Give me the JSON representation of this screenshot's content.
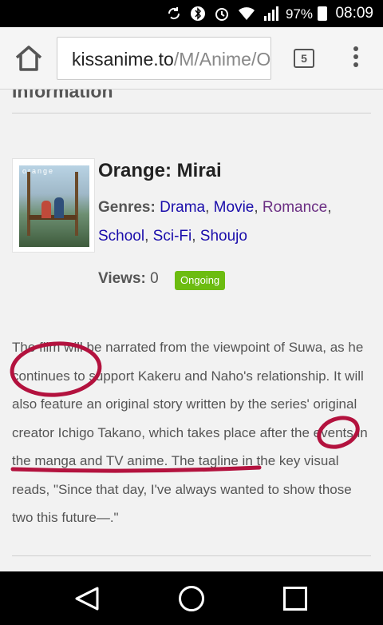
{
  "status_bar": {
    "battery": "97%",
    "time": "08:09",
    "icons": [
      "sync-icon",
      "bluetooth-icon",
      "alarm-icon",
      "wifi-icon",
      "signal-icon",
      "battery-icon"
    ]
  },
  "browser": {
    "url_host": "kissanime.to",
    "url_path": "/M/Anime/Orange-Mirai",
    "tab_count": "5"
  },
  "page": {
    "section_title": "Information",
    "anime_title": "Orange: Mirai",
    "genres_label": "Genres:",
    "genres": [
      "Drama",
      "Movie",
      "Romance",
      "School",
      "Sci-Fi",
      "Shoujo"
    ],
    "views_label": "Views:",
    "views_value": "0",
    "status_badge": "Ongoing",
    "description": "The film will be narrated from the viewpoint of Suwa, as he continues to support Kakeru and Naho's relationship. It will also feature an original story written by the series' original creator Ichigo Takano, which takes place after the events in the manga and TV anime. The tagline in the key visual reads, \"Since that day, I've always wanted to show those two this future—.\""
  },
  "colors": {
    "link": "#1a0dab",
    "visited_link": "#6b2e83",
    "badge": "#6cbc10",
    "annotation": "#b3123e"
  }
}
